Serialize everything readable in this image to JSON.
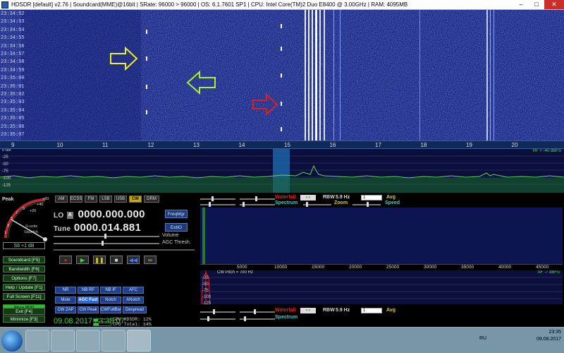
{
  "window": {
    "title": "HDSDR [default]  v2.76  |  Soundcard(MME)@16bit  |  SRate: 96000 > 96000  |  OS: 6.1.7601 SP1  |  CPU: Intel Core(TM)2 Duo      E8400  @ 3.00GHz  |  RAM: 4095MB",
    "minimize": "–",
    "maximize": "□",
    "close": "✕"
  },
  "waterfall": {
    "timestamps": [
      "23:34:52",
      "23:34:53",
      "23:34:54",
      "23:34:55",
      "23:34:56",
      "23:34:57",
      "23:34:58",
      "23:34:59",
      "23:35:00",
      "23:35:01",
      "23:35:02",
      "23:35:03",
      "23:35:04",
      "23:35:05",
      "23:35:06",
      "23:35:07"
    ],
    "arrows": {
      "yellow": "#f0f020",
      "green": "#a8f030",
      "red": "#e02020"
    }
  },
  "freq_scale": {
    "ticks": [
      "9",
      "10",
      "11",
      "12",
      "13",
      "14",
      "15",
      "16",
      "17",
      "18",
      "19",
      "20"
    ]
  },
  "spectrum": {
    "db_labels": [
      "0 dB",
      "-25",
      "-50",
      "-75",
      "-100",
      "-125"
    ],
    "rf_label": "RF < -40 dBFS"
  },
  "smeter": {
    "title": "Peak",
    "scale": [
      "1",
      "3",
      "5",
      "7",
      "9",
      "+20",
      "+40",
      "+60"
    ],
    "units": "S-units",
    "mode": "Squelch",
    "reading": "S6 +1 dB"
  },
  "left_buttons": [
    {
      "label": "Soundcard  [F5]"
    },
    {
      "label": "Bandwidth  [F6]"
    },
    {
      "label": "Options  [F7]"
    },
    {
      "label": "Help / Update  [F1]"
    },
    {
      "label": "Full Screen  [F11]"
    },
    {
      "label": "Stop  [F2]"
    },
    {
      "label": "Minimize  [F3]"
    },
    {
      "label": "Exit  [F4]"
    }
  ],
  "modes": [
    "AM",
    "ECSS",
    "FM",
    "LSB",
    "USB",
    "CW",
    "DRM"
  ],
  "active_mode": "CW",
  "lo": {
    "label": "LO",
    "a_button": "A",
    "value": "0000.000.000"
  },
  "tune": {
    "label": "Tune",
    "value": "0000.014.881"
  },
  "freqmgr_button": "FreqMgr",
  "extio_button": "ExtIO",
  "volume_label": "Volume",
  "agc_label": "AGC Thresh.",
  "transport": [
    "●",
    "▶",
    "❚❚",
    "■",
    "◀◀",
    "∞"
  ],
  "dsp_buttons": [
    {
      "label": "NR"
    },
    {
      "label": "NB RF"
    },
    {
      "label": "NB IF"
    },
    {
      "label": "AFC"
    },
    {
      "label": "Mute"
    },
    {
      "label": "AGC Fast"
    },
    {
      "label": "Notch"
    },
    {
      "label": "ANotch"
    },
    {
      "label": "CW ZAP"
    },
    {
      "label": "CW Peak"
    },
    {
      "label": "CWFullBw"
    },
    {
      "label": "Despread"
    }
  ],
  "datetime": "09.08.2017  23:35:07",
  "cpu": {
    "hdsdr": "CPU HDSDR:  12%",
    "total": "CPU Total:  14%",
    "hdsdr_level": 0.12,
    "total_level": 0.14
  },
  "top_panel": {
    "waterfall_label": "Waterfall",
    "spectrum_label": "Spectrum",
    "rbw_label": "RBW",
    "rbw_value": "5.9 Hz",
    "avg_value": "1",
    "avg_label": "Avg",
    "zoom_label": "Zoom",
    "speed_label": "Speed"
  },
  "audio_scale": [
    "5000",
    "10000",
    "15000",
    "20000",
    "25000",
    "30000",
    "35000",
    "40000",
    "45000"
  ],
  "audio": {
    "cw_pitch": "CW Pitch = 700 Hz",
    "af_label": "AF -7 dBFS",
    "db_labels": [
      "-25",
      "-50",
      "-75",
      "-100",
      "-125"
    ]
  },
  "bottom_panel": {
    "waterfall_label": "Waterfall",
    "spectrum_label": "Spectrum",
    "rbw_label": "RBW",
    "rbw_value": "5.9 Hz",
    "avg_value": "1",
    "avg_label": "Avg"
  },
  "taskbar": {
    "lang": "RU",
    "time": "23:35",
    "date": "09.08.2017"
  }
}
